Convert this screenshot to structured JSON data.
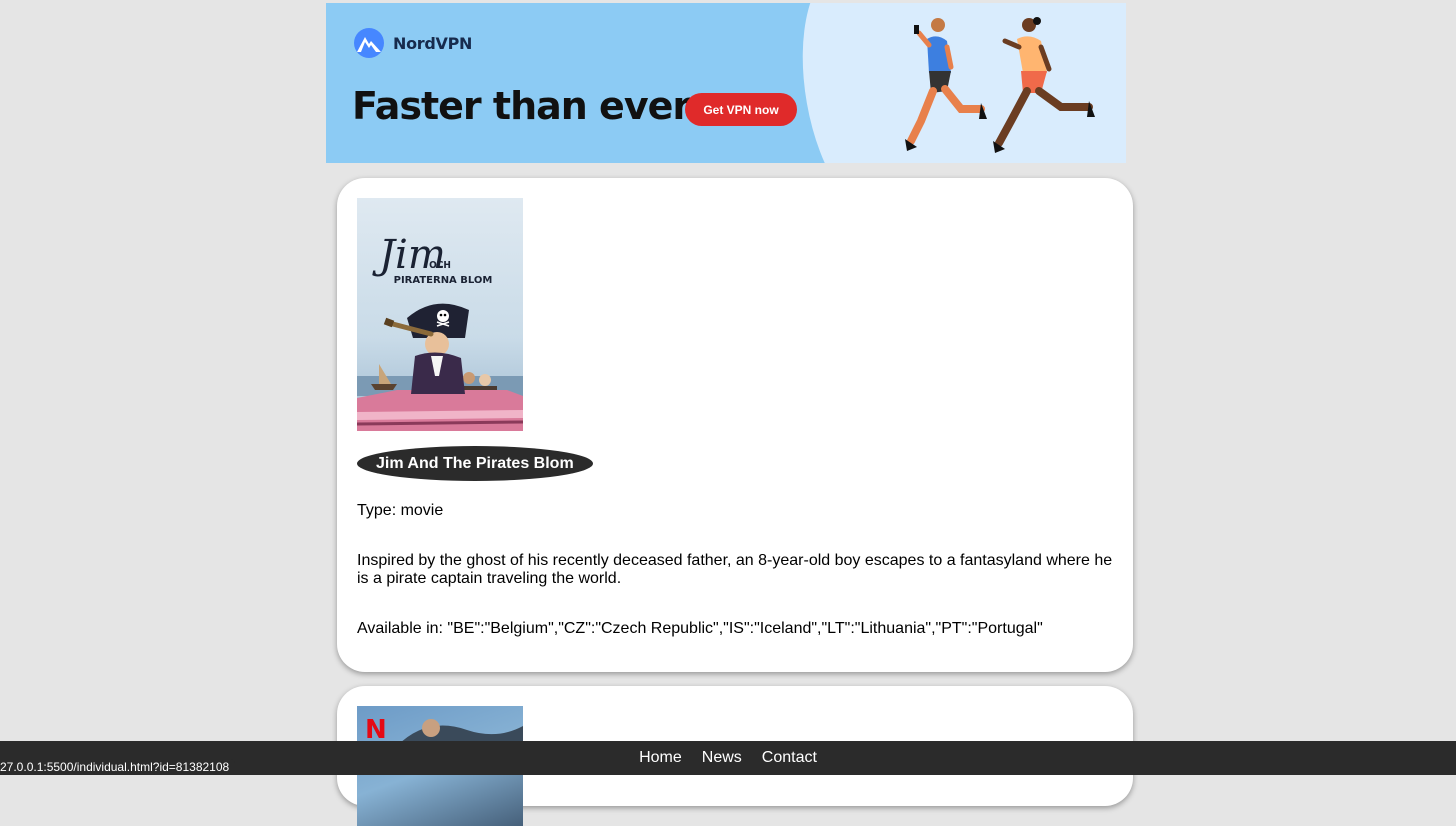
{
  "ad": {
    "brand": "NordVPN",
    "headline": "Faster than ever",
    "cta": "Get VPN now"
  },
  "cards": [
    {
      "title": "Jim And The Pirates Blom",
      "type": "Type: movie",
      "description": "Inspired by the ghost of his recently deceased father, an 8-year-old boy escapes to a fantasyland where he is a pirate captain traveling the world.",
      "available": "Available in: \"BE\":\"Belgium\",\"CZ\":\"Czech Republic\",\"IS\":\"Iceland\",\"LT\":\"Lithuania\",\"PT\":\"Portugal\"",
      "poster_text": {
        "script": "Jim",
        "line1": "OCH",
        "line2": "PIRATERNA BLOM"
      }
    },
    {
      "poster_badge": "N"
    }
  ],
  "footer": {
    "links": [
      "Home",
      "News",
      "Contact"
    ]
  },
  "status_bar": {
    "url": "27.0.0.1:5500/individual.html?id=81382108"
  }
}
